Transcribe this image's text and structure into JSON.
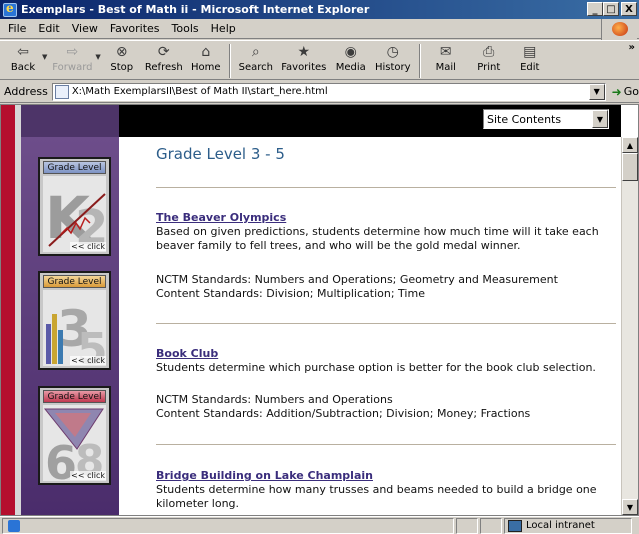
{
  "window": {
    "title": "Exemplars - Best of Math ii - Microsoft Internet Explorer",
    "controls": {
      "minimize": "_",
      "maximize": "□",
      "close": "X"
    }
  },
  "menu": [
    "File",
    "Edit",
    "View",
    "Favorites",
    "Tools",
    "Help"
  ],
  "toolbar": {
    "back": "Back",
    "forward": "Forward",
    "stop": "Stop",
    "refresh": "Refresh",
    "home": "Home",
    "search": "Search",
    "favorites": "Favorites",
    "media": "Media",
    "history": "History",
    "mail": "Mail",
    "print": "Print",
    "edit": "Edit",
    "more": "»"
  },
  "address": {
    "label": "Address",
    "value": "X:\\Math ExemplarsII\\Best of Math II\\start_here.html",
    "go": "Go"
  },
  "site_nav": {
    "selected": "Site Contents"
  },
  "sidebar": {
    "cards": [
      {
        "title": "Grade Level",
        "click": "<< click",
        "digits": "K2"
      },
      {
        "title": "Grade Level",
        "click": "<< click",
        "digits": "35"
      },
      {
        "title": "Grade Level",
        "click": "<< click",
        "digits": "68"
      }
    ]
  },
  "page": {
    "title": "Grade Level 3 - 5",
    "entries": [
      {
        "title": "The Beaver Olympics",
        "desc": "Based on given predictions, students determine how much time will it take each beaver family to fell trees, and who will be the gold medal winner.",
        "nctm": "NCTM Standards: Numbers and Operations; Geometry and Measurement",
        "content": "Content Standards: Division; Multiplication; Time"
      },
      {
        "title": "Book Club",
        "desc": "Students determine which purchase option is better for the book club selection.",
        "nctm": "NCTM Standards: Numbers and Operations",
        "content": "Content Standards: Addition/Subtraction; Division; Money; Fractions"
      },
      {
        "title": "Bridge Building on Lake Champlain",
        "desc": "Students determine how many trusses and beams needed to build a bridge one kilometer long."
      }
    ]
  },
  "status": {
    "zone": "Local intranet"
  },
  "colors": {
    "title_blue": "#2c5d8a",
    "link_purple": "#3a2d7c",
    "sidebar_purple": "#5a3b7a",
    "strip_red": "#b50f2e"
  }
}
